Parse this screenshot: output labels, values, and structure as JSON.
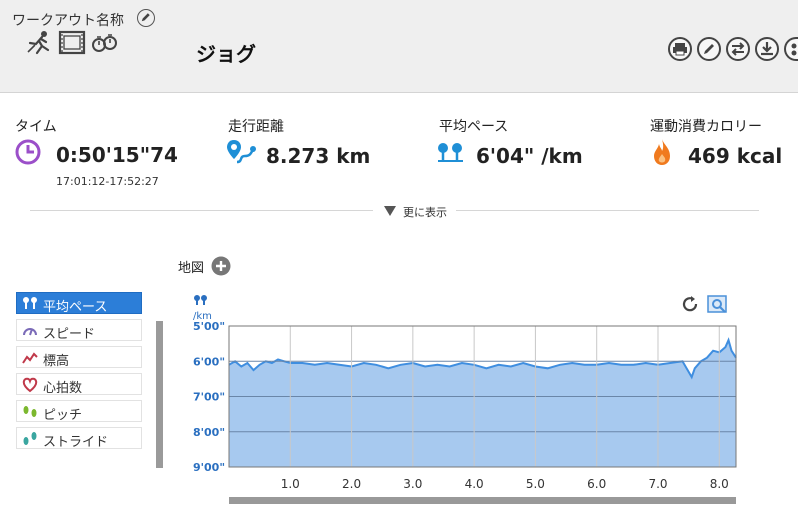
{
  "workout": {
    "name_label": "ワークアウト名称",
    "title": "ジョグ"
  },
  "icons": {
    "name_edit": "pencil-icon",
    "activity_types": [
      "runner-icon",
      "film-icon",
      "stopwatch-icon"
    ],
    "tools": [
      "print-icon",
      "edit-icon",
      "swap-icon",
      "download-icon",
      "share-icon"
    ]
  },
  "stats": [
    {
      "label": "タイム",
      "value": "0:50'15\"74",
      "icon": "clock-icon",
      "sub": "17:01:12-17:52:27"
    },
    {
      "label": "走行距離",
      "value": "8.273 km",
      "icon": "route-pin-icon"
    },
    {
      "label": "平均ペース",
      "value": "6'04\" /km",
      "icon": "pace-pins-icon"
    },
    {
      "label": "運動消費カロリー",
      "value": "469 kcal",
      "icon": "flame-icon"
    }
  ],
  "more_label": "更に表示",
  "map": {
    "label": "地図"
  },
  "metrics": [
    {
      "label": "平均ペース",
      "icon": "pace-pins-icon",
      "active": true
    },
    {
      "label": "スピード",
      "icon": "speedometer-icon",
      "active": false
    },
    {
      "label": "標高",
      "icon": "elevation-icon",
      "active": false
    },
    {
      "label": "心拍数",
      "icon": "heart-icon",
      "active": false
    },
    {
      "label": "ピッチ",
      "icon": "footprints-icon",
      "active": false
    },
    {
      "label": "ストライド",
      "icon": "stride-icon",
      "active": false
    }
  ],
  "colors": {
    "accent": "#2c7ed8",
    "chart_fill": "#a7c9ef",
    "chart_line": "#3f8ee0",
    "clock": "#9b4fc9",
    "route": "#1f8fd6",
    "flame": "#f07a1e"
  },
  "chart_data": {
    "type": "area",
    "xlabel": "",
    "ylabel": "/km",
    "y_ticks": [
      "5'00\"",
      "6'00\"",
      "7'00\"",
      "8'00\"",
      "9'00\""
    ],
    "x_ticks": [
      "1.0",
      "2.0",
      "3.0",
      "4.0",
      "5.0",
      "6.0",
      "7.0",
      "8.0"
    ],
    "ylim_min_per_km": [
      5.0,
      9.0
    ],
    "y_inverted": true,
    "xlim_km": [
      0,
      8.273
    ],
    "grid": true,
    "series": [
      {
        "x": [
          0,
          0.1,
          0.2,
          0.3,
          0.4,
          0.5,
          0.6,
          0.7,
          0.8,
          0.9,
          1.0,
          1.2,
          1.4,
          1.6,
          1.8,
          2.0,
          2.2,
          2.4,
          2.6,
          2.8,
          3.0,
          3.2,
          3.4,
          3.6,
          3.8,
          4.0,
          4.2,
          4.4,
          4.6,
          4.8,
          5.0,
          5.2,
          5.4,
          5.6,
          5.8,
          6.0,
          6.2,
          6.4,
          6.6,
          6.8,
          7.0,
          7.2,
          7.4,
          7.5,
          7.55,
          7.6,
          7.7,
          7.8,
          7.9,
          8.0,
          8.1,
          8.15,
          8.2,
          8.273
        ],
        "y": [
          6.1,
          6.0,
          6.15,
          6.05,
          6.25,
          6.1,
          6.0,
          6.05,
          5.95,
          6.0,
          6.05,
          6.05,
          6.1,
          6.05,
          6.1,
          6.15,
          6.05,
          6.1,
          6.2,
          6.1,
          6.05,
          6.15,
          6.1,
          6.15,
          6.05,
          6.1,
          6.2,
          6.1,
          6.15,
          6.05,
          6.15,
          6.2,
          6.1,
          6.05,
          6.1,
          6.1,
          6.05,
          6.1,
          6.1,
          6.05,
          6.1,
          6.05,
          6.0,
          6.3,
          6.45,
          6.2,
          6.0,
          5.9,
          5.7,
          5.75,
          5.6,
          5.4,
          5.7,
          5.9
        ]
      }
    ]
  }
}
